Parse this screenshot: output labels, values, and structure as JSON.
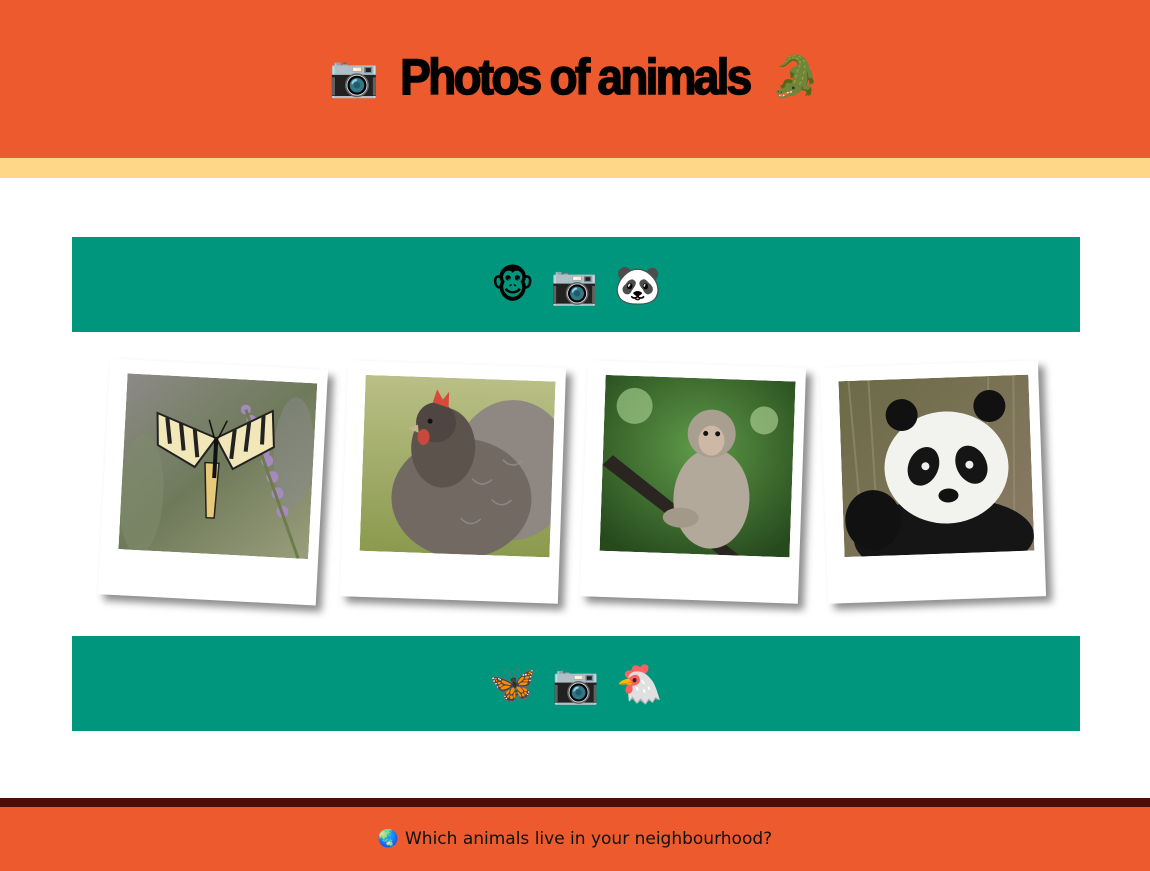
{
  "header": {
    "left_icon": "camera-icon",
    "left_emoji": "📷",
    "title": "Photos of animals",
    "right_icon": "crocodile-icon",
    "right_emoji": "🐊"
  },
  "top_band": {
    "icons": [
      "monkey-face-icon",
      "camera-icon",
      "panda-icon"
    ],
    "emojis": [
      "🐵",
      "📷",
      "🐼"
    ]
  },
  "gallery": {
    "photos": [
      {
        "subject": "butterfly-photo"
      },
      {
        "subject": "hen-photo"
      },
      {
        "subject": "monkey-photo"
      },
      {
        "subject": "panda-photo"
      }
    ]
  },
  "bottom_band": {
    "icons": [
      "butterfly-icon",
      "camera-icon",
      "rooster-icon"
    ],
    "emojis": [
      "🦋",
      "📷",
      "🐔"
    ]
  },
  "footer": {
    "icon": "globe-icon",
    "emoji": "🌏",
    "text": "Which animals live in your neighbourhood?"
  },
  "colors": {
    "header_bg": "#ec5a2d",
    "stripe": "#fed788",
    "band": "#00957d",
    "footer_dark": "#4d0e06"
  }
}
